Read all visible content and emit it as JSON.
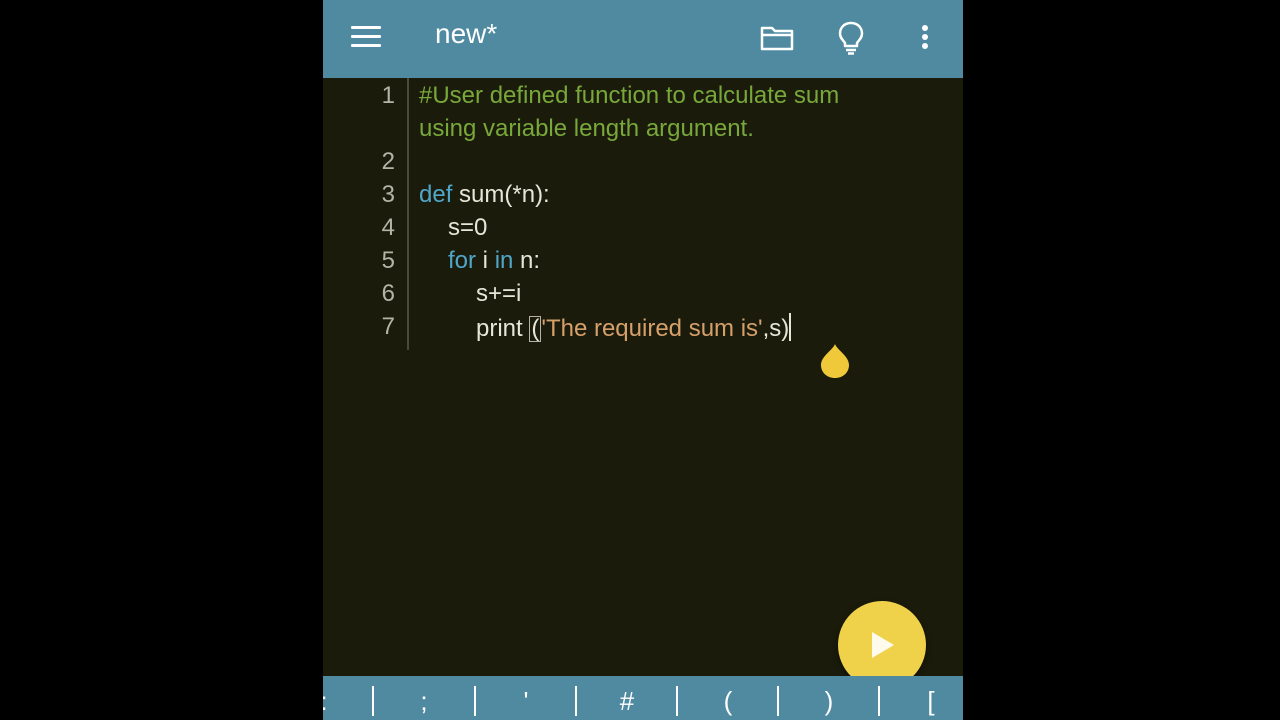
{
  "appbar": {
    "title": "new*",
    "icons": [
      "menu-icon",
      "folder-icon",
      "lightbulb-icon",
      "more-vert-icon"
    ],
    "color": "#4f8aa0"
  },
  "editor": {
    "line_numbers": [
      "1",
      "2",
      "3",
      "4",
      "5",
      "6",
      "7"
    ],
    "line1_comment_a": "#User defined function to calculate sum",
    "line1_comment_b": "using variable length argument.",
    "line3_kw": "def",
    "line3_rest": " sum(*n):",
    "line4": "s=0",
    "line5_kw1": "for",
    "line5_mid": " i ",
    "line5_kw2": "in",
    "line5_rest": " n:",
    "line6": "s+=i",
    "line7_print": "print ",
    "line7_open": "(",
    "line7_string": "'The required sum is'",
    "line7_tail": ",s)",
    "colors": {
      "background": "#1b1b0c",
      "comment": "#78a83a",
      "keyword": "#4fa6c8",
      "string": "#d6a06a"
    }
  },
  "run_button": {
    "icon": "play-icon",
    "color": "#f0d24a"
  },
  "keybar": {
    "keys": [
      ":",
      ";",
      "'",
      "#",
      "(",
      ")",
      "["
    ]
  }
}
